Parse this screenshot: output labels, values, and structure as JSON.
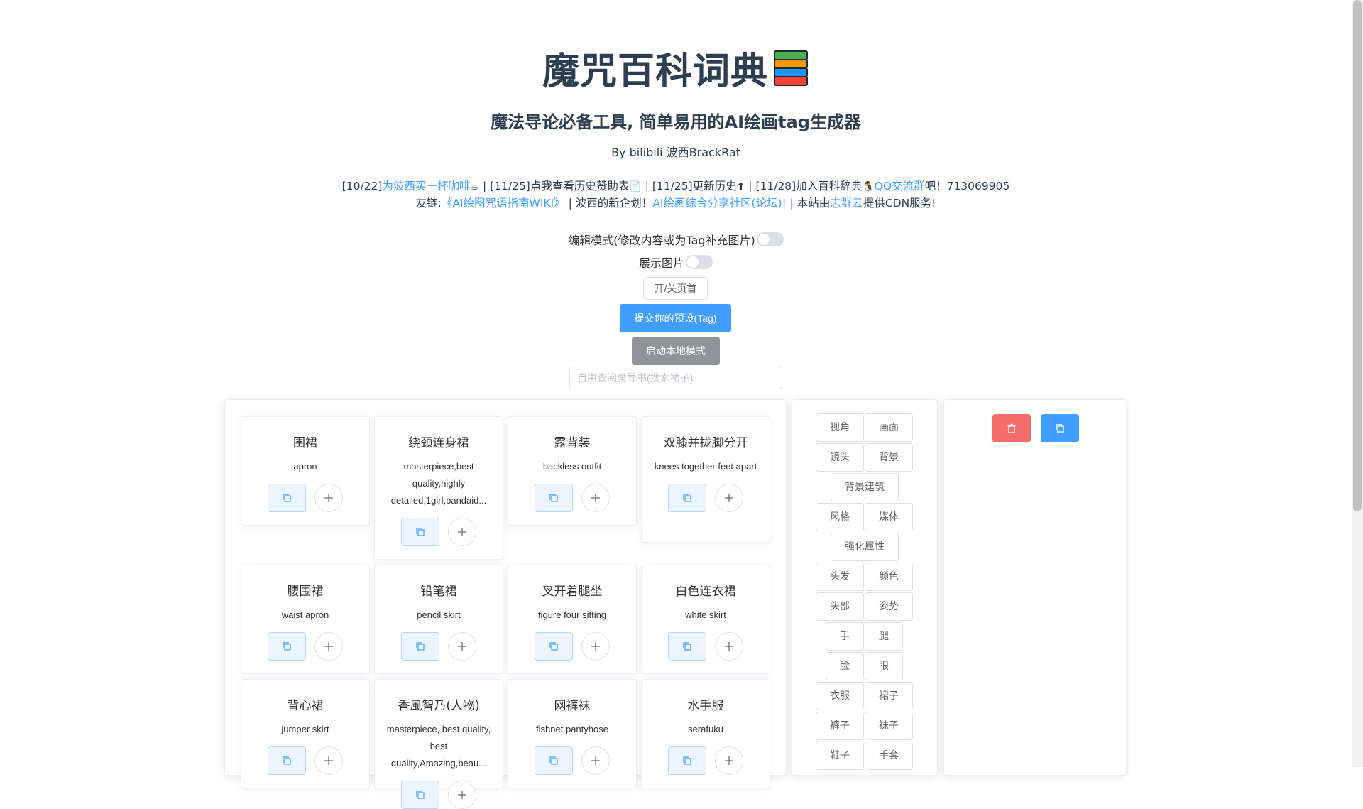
{
  "header": {
    "title": "魔咒百科词典",
    "subtitle": "魔法导论必备工具, 简单易用的AI绘画tag生成器",
    "author": "By bilibili 波西BrackRat"
  },
  "notice_line1": {
    "p1": "[10/22]",
    "link_coffee": "为波西买一杯咖啡",
    "p2": " | [11/25]点我查看历史赞助表",
    "p3": " | [11/25]更新历史",
    "p4": " | [11/28]加入百科辞典",
    "link_qq": "QQ交流群",
    "p5": "吧！713069905"
  },
  "notice_line2": {
    "p1": "友链:",
    "link_wiki": "《AI绘图咒语指南WIKI》",
    "p2": " | 波西的新企划！",
    "link_forum": "AI绘画综合分享社区(论坛)!",
    "p3": " | 本站由",
    "link_cdn": "志群云",
    "p4": "提供CDN服务!"
  },
  "controls": {
    "edit_mode_label": "编辑模式(修改内容或为Tag补充图片)",
    "show_image_label": "展示图片",
    "toggle_header_button": "开/关页首",
    "submit_preset_button": "提交你的预设(Tag)",
    "local_mode_button": "启动本地模式",
    "search_placeholder": "自由查阅魔导书(搜索裙子)"
  },
  "cards": [
    {
      "name": "围裙",
      "tag": "apron"
    },
    {
      "name": "绕颈连身裙",
      "tag": "masterpiece,best quality,highly detailed,1girl,bandaid..."
    },
    {
      "name": "露背装",
      "tag": "backless outfit"
    },
    {
      "name": "双膝并拢脚分开",
      "tag": "knees together feet apart"
    },
    {
      "name": "腰围裙",
      "tag": "waist apron"
    },
    {
      "name": "铅笔裙",
      "tag": "pencil skirt"
    },
    {
      "name": "叉开着腿坐",
      "tag": "figure four sitting"
    },
    {
      "name": "白色连衣裙",
      "tag": "white skirt"
    },
    {
      "name": "背心裙",
      "tag": "jumper skirt"
    },
    {
      "name": "香風智乃(人物)",
      "tag": "masterpiece, best quality, best quality,Amazing,beau..."
    },
    {
      "name": "网裤袜",
      "tag": "fishnet pantyhose"
    },
    {
      "name": "水手服",
      "tag": "serafuku"
    }
  ],
  "categories": [
    "视角",
    "画面",
    "镜头",
    "背景",
    "背景建筑",
    "风格",
    "媒体",
    "强化属性",
    "头发",
    "颜色",
    "头部",
    "姿势",
    "手",
    "腿",
    "脸",
    "眼",
    "衣服",
    "裙子",
    "裤子",
    "袜子",
    "鞋子",
    "手套"
  ],
  "colors": {
    "primary": "#409eff",
    "danger": "#f56c6c",
    "info": "#909399",
    "text": "#2c3e50"
  }
}
